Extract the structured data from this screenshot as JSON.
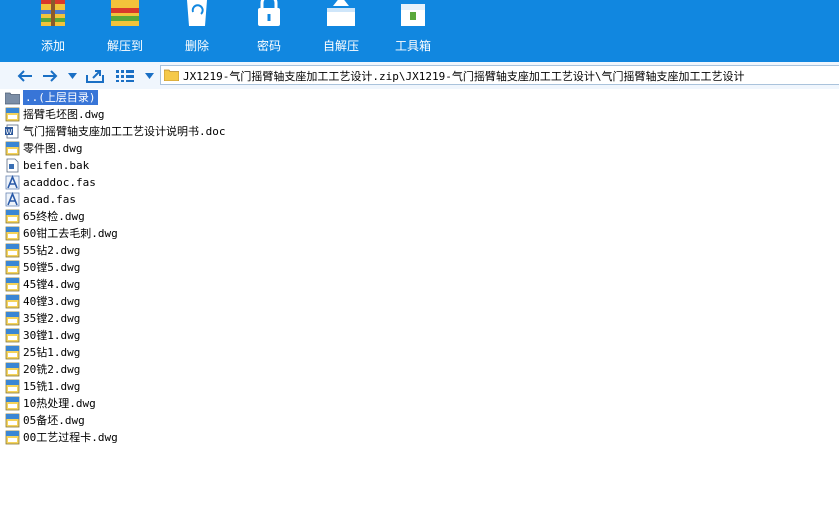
{
  "toolbar": {
    "items": [
      {
        "label": "添加",
        "icon": "add-archive-icon"
      },
      {
        "label": "解压到",
        "icon": "extract-to-icon"
      },
      {
        "label": "删除",
        "icon": "recycle-bin-icon"
      },
      {
        "label": "密码",
        "icon": "lock-icon"
      },
      {
        "label": "自解压",
        "icon": "self-extract-icon"
      },
      {
        "label": "工具箱",
        "icon": "toolbox-icon"
      }
    ]
  },
  "addressbar": {
    "path": "JX1219-气门摇臂轴支座加工工艺设计.zip\\JX1219-气门摇臂轴支座加工工艺设计\\气门摇臂轴支座加工工艺设计"
  },
  "files": [
    {
      "name": "..(上层目录)",
      "type": "parent",
      "selected": true
    },
    {
      "name": "摇臂毛坯图.dwg",
      "type": "dwg"
    },
    {
      "name": "气门摇臂轴支座加工工艺设计说明书.doc",
      "type": "doc"
    },
    {
      "name": "零件图.dwg",
      "type": "dwg"
    },
    {
      "name": "beifen.bak",
      "type": "bak"
    },
    {
      "name": "acaddoc.fas",
      "type": "fas"
    },
    {
      "name": "acad.fas",
      "type": "fas"
    },
    {
      "name": "65终检.dwg",
      "type": "dwg"
    },
    {
      "name": "60钳工去毛刺.dwg",
      "type": "dwg"
    },
    {
      "name": "55钻2.dwg",
      "type": "dwg"
    },
    {
      "name": "50镗5.dwg",
      "type": "dwg"
    },
    {
      "name": "45镗4.dwg",
      "type": "dwg"
    },
    {
      "name": "40镗3.dwg",
      "type": "dwg"
    },
    {
      "name": "35镗2.dwg",
      "type": "dwg"
    },
    {
      "name": "30镗1.dwg",
      "type": "dwg"
    },
    {
      "name": "25钻1.dwg",
      "type": "dwg"
    },
    {
      "name": "20铣2.dwg",
      "type": "dwg"
    },
    {
      "name": "15铣1.dwg",
      "type": "dwg"
    },
    {
      "name": "10热处理.dwg",
      "type": "dwg"
    },
    {
      "name": "05备坯.dwg",
      "type": "dwg"
    },
    {
      "name": "00工艺过程卡.dwg",
      "type": "dwg"
    }
  ],
  "colors": {
    "toolbar_bg": "#1187e0",
    "selection": "#3875d7",
    "nav_arrow": "#1a6fc4"
  }
}
